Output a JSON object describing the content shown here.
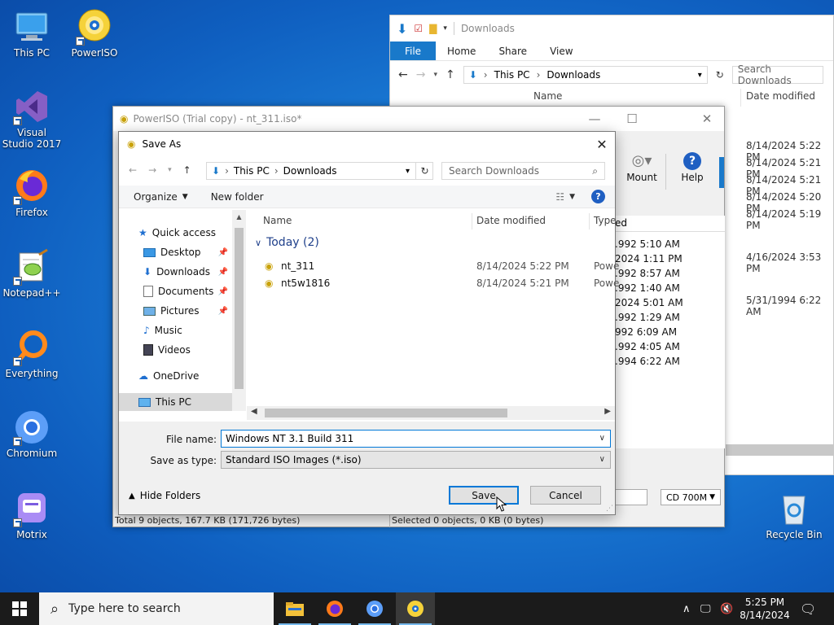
{
  "desktop": {
    "icons": [
      {
        "label": "This PC"
      },
      {
        "label": "PowerISO"
      },
      {
        "label": "Visual Studio 2017"
      },
      {
        "label": "Firefox"
      },
      {
        "label": "Notepad++"
      },
      {
        "label": "Everything"
      },
      {
        "label": "Chromium"
      },
      {
        "label": "Motrix"
      },
      {
        "label": "Recycle Bin"
      }
    ]
  },
  "explorer": {
    "title": "Downloads",
    "tabs": {
      "file": "File",
      "home": "Home",
      "share": "Share",
      "view": "View"
    },
    "path": {
      "root": "This PC",
      "folder": "Downloads"
    },
    "search_placeholder": "Search Downloads",
    "columns": {
      "name": "Name",
      "date": "Date modified"
    },
    "dates": [
      "8/14/2024 5:22 PM",
      "8/14/2024 5:21 PM",
      "8/14/2024 5:21 PM",
      "8/14/2024 5:20 PM",
      "8/14/2024 5:19 PM",
      "4/16/2024 3:53 PM",
      "5/31/1994 6:22 AM"
    ]
  },
  "poweriso": {
    "title": "PowerISO (Trial copy) - nt_311.iso*",
    "toolbar": {
      "mount": "Mount",
      "help": "Help"
    },
    "list_header_fragment": "ed",
    "list_dates": [
      ".992 5:10 AM",
      "2024 1:11 PM",
      ".992 8:57 AM",
      ".992 1:40 AM",
      "2024 5:01 AM",
      ".992 1:29 AM",
      "992 6:09 AM",
      ".992 4:05 AM",
      ".994 6:22 AM"
    ],
    "cd_size": "CD 700M",
    "status_left": "Total 9 objects, 167.7 KB (171,726 bytes)",
    "status_right": "Selected 0 objects, 0 KB (0 bytes)"
  },
  "dialog": {
    "title": "Save As",
    "path": {
      "root": "This PC",
      "folder": "Downloads"
    },
    "search_placeholder": "Search Downloads",
    "commands": {
      "organize": "Organize",
      "new_folder": "New folder"
    },
    "nav": {
      "quick_access": "Quick access",
      "desktop": "Desktop",
      "downloads": "Downloads",
      "documents": "Documents",
      "pictures": "Pictures",
      "music": "Music",
      "videos": "Videos",
      "onedrive": "OneDrive",
      "this_pc": "This PC"
    },
    "columns": {
      "name": "Name",
      "date": "Date modified",
      "type": "Type"
    },
    "group": "Today (2)",
    "files": [
      {
        "name": "nt_311",
        "date": "8/14/2024 5:22 PM",
        "type": "Powe"
      },
      {
        "name": "nt5w1816",
        "date": "8/14/2024 5:21 PM",
        "type": "Powe"
      }
    ],
    "file_name_label": "File name:",
    "file_name_value": "Windows NT 3.1 Build 311",
    "save_type_label": "Save as type:",
    "save_type_value": "Standard ISO Images (*.iso)",
    "hide_folders": "Hide Folders",
    "save": "Save",
    "cancel": "Cancel"
  },
  "taskbar": {
    "search_placeholder": "Type here to search",
    "time": "5:25 PM",
    "date": "8/14/2024"
  },
  "colors": {
    "accent": "#0078d7",
    "explorer_file_tab": "#1979ca",
    "taskbar": "#1b1b1b"
  }
}
